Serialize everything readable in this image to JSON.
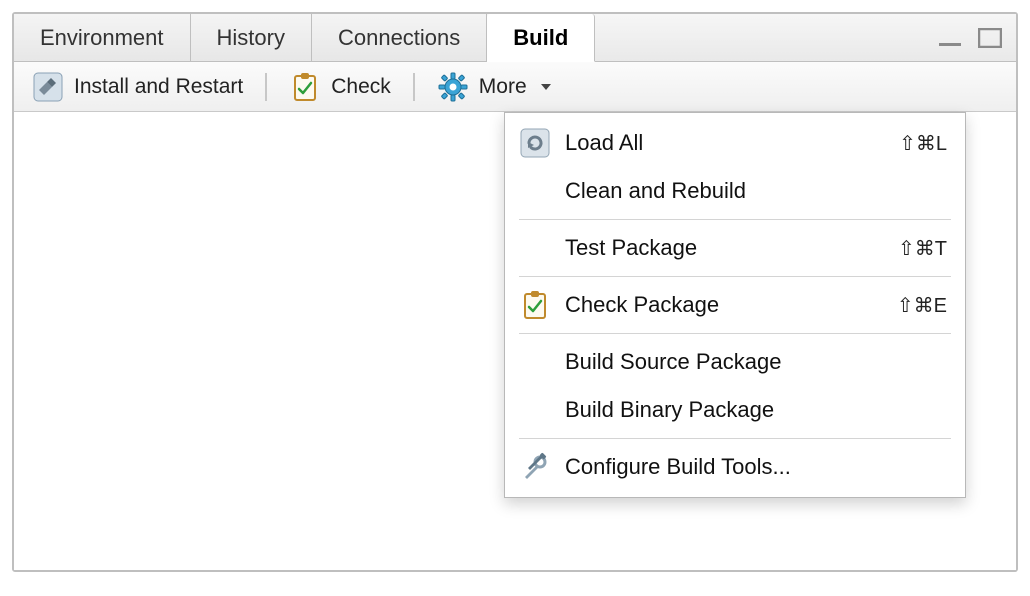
{
  "tabs": {
    "environment": "Environment",
    "history": "History",
    "connections": "Connections",
    "build": "Build"
  },
  "toolbar": {
    "install_restart": "Install and Restart",
    "check": "Check",
    "more": "More"
  },
  "menu": {
    "load_all": {
      "label": "Load All",
      "shortcut": "⇧⌘L"
    },
    "clean_rebuild": {
      "label": "Clean and Rebuild"
    },
    "test_package": {
      "label": "Test Package",
      "shortcut": "⇧⌘T"
    },
    "check_package": {
      "label": "Check Package",
      "shortcut": "⇧⌘E"
    },
    "build_source": {
      "label": "Build Source Package"
    },
    "build_binary": {
      "label": "Build Binary Package"
    },
    "configure": {
      "label": "Configure Build Tools..."
    }
  }
}
